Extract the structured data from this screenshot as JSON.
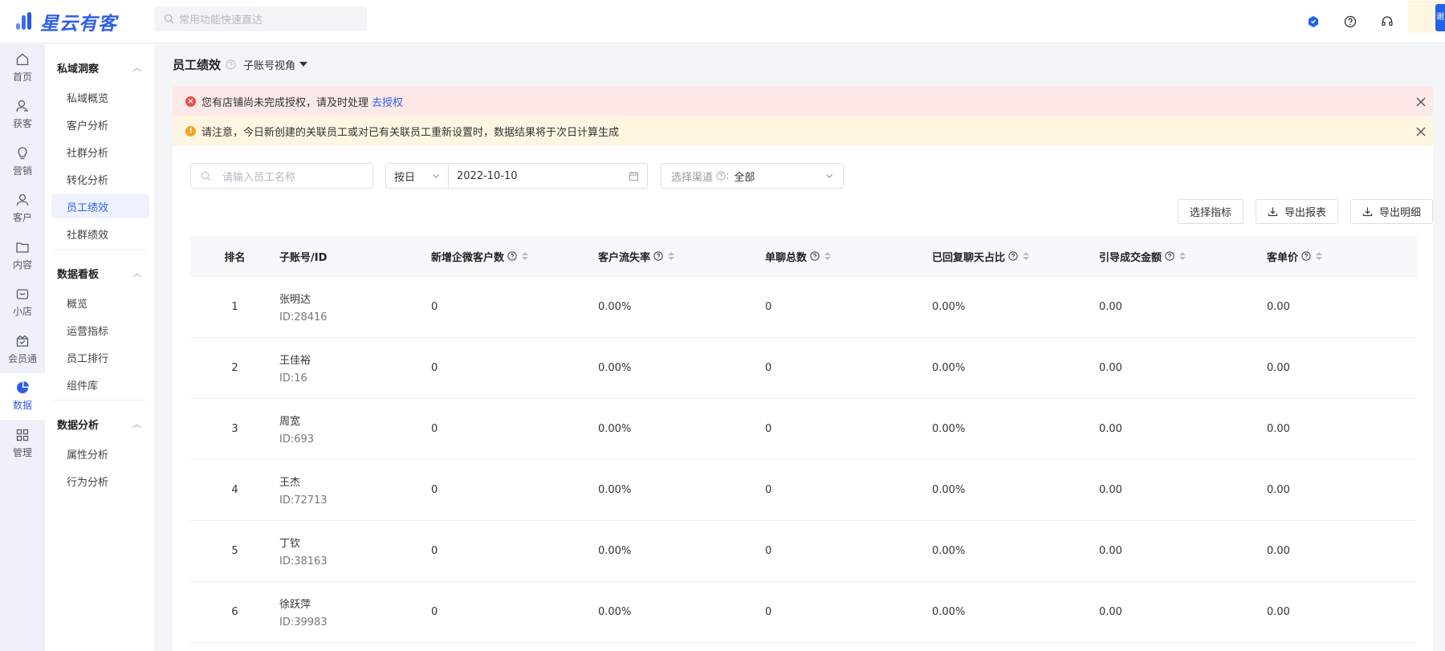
{
  "app": {
    "brand": "星云有客",
    "search_placeholder": "常用功能快速直达",
    "user_initial": "谢"
  },
  "rail": [
    {
      "label": "首页",
      "icon": "home-icon"
    },
    {
      "label": "获客",
      "icon": "acquire-icon"
    },
    {
      "label": "营销",
      "icon": "bulb-icon"
    },
    {
      "label": "客户",
      "icon": "user-icon"
    },
    {
      "label": "内容",
      "icon": "folder-icon"
    },
    {
      "label": "小店",
      "icon": "shop-icon"
    },
    {
      "label": "会员通",
      "icon": "member-icon"
    },
    {
      "label": "数据",
      "icon": "pie-chart-icon",
      "active": true
    },
    {
      "label": "管理",
      "icon": "grid-icon"
    }
  ],
  "subnav": {
    "sections": [
      {
        "title": "私域洞察",
        "items": [
          "私域概览",
          "客户分析",
          "社群分析",
          "转化分析",
          "员工绩效",
          "社群绩效"
        ]
      },
      {
        "title": "数据看板",
        "items": [
          "概览",
          "运营指标",
          "员工排行",
          "组件库"
        ]
      },
      {
        "title": "数据分析",
        "items": [
          "属性分析",
          "行为分析"
        ]
      }
    ],
    "active": "员工绩效"
  },
  "page": {
    "title": "员工绩效",
    "view": "子账号视角"
  },
  "alerts": {
    "error": {
      "text": "您有店铺尚未完成授权，请及时处理",
      "link": "去授权"
    },
    "warning": {
      "text": "请注意，今日新创建的关联员工或对已有关联员工重新设置时，数据结果将于次日计算生成"
    }
  },
  "filters": {
    "search_placeholder": "请输入员工名称",
    "date_unit": "按日",
    "date_value": "2022-10-10",
    "channel_label": "选择渠道",
    "channel_value": "全部"
  },
  "actions": {
    "select_metrics": "选择指标",
    "export_report": "导出报表",
    "export_detail": "导出明细"
  },
  "table": {
    "headers": [
      "排名",
      "子账号/ID",
      "新增企微客户数",
      "客户流失率",
      "单聊总数",
      "已回复聊天占比",
      "引导成交金额",
      "客单价"
    ],
    "rows": [
      {
        "rank": "1",
        "name": "张明达",
        "id": "ID:28416",
        "new_customers": "0",
        "churn": "0.00%",
        "chats": "0",
        "reply_ratio": "0.00%",
        "gmv": "0.00",
        "aov": "0.00"
      },
      {
        "rank": "2",
        "name": "王佳裕",
        "id": "ID:16",
        "new_customers": "0",
        "churn": "0.00%",
        "chats": "0",
        "reply_ratio": "0.00%",
        "gmv": "0.00",
        "aov": "0.00"
      },
      {
        "rank": "3",
        "name": "周宽",
        "id": "ID:693",
        "new_customers": "0",
        "churn": "0.00%",
        "chats": "0",
        "reply_ratio": "0.00%",
        "gmv": "0.00",
        "aov": "0.00"
      },
      {
        "rank": "4",
        "name": "王杰",
        "id": "ID:72713",
        "new_customers": "0",
        "churn": "0.00%",
        "chats": "0",
        "reply_ratio": "0.00%",
        "gmv": "0.00",
        "aov": "0.00"
      },
      {
        "rank": "5",
        "name": "丁钦",
        "id": "ID:38163",
        "new_customers": "0",
        "churn": "0.00%",
        "chats": "0",
        "reply_ratio": "0.00%",
        "gmv": "0.00",
        "aov": "0.00"
      },
      {
        "rank": "6",
        "name": "徐跃萍",
        "id": "ID:39983",
        "new_customers": "0",
        "churn": "0.00%",
        "chats": "0",
        "reply_ratio": "0.00%",
        "gmv": "0.00",
        "aov": "0.00"
      }
    ]
  }
}
